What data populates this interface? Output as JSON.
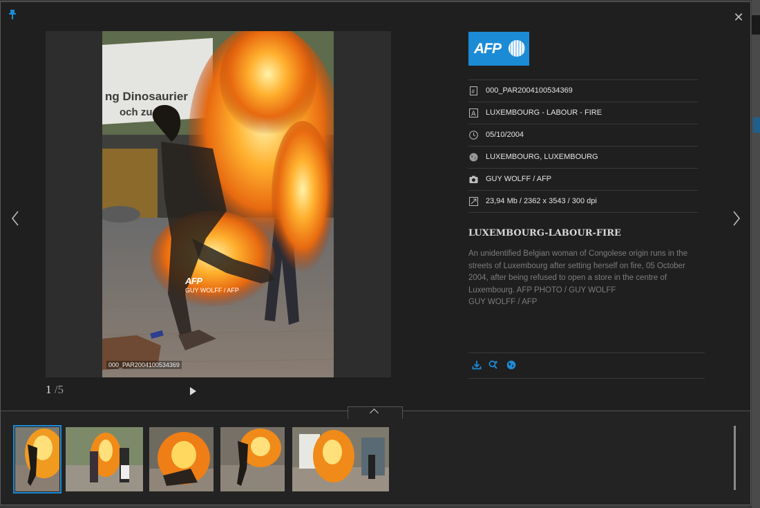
{
  "viewer": {
    "close_glyph": "✕",
    "counter": {
      "current": "1",
      "total": "/5"
    }
  },
  "photo": {
    "watermark_logo": "AFP",
    "watermark_credit": "GUY WOLFF / AFP",
    "id_tag": "000_PAR2004100534369"
  },
  "agency_logo": "AFP",
  "metadata": [
    {
      "icon": "document-id-icon",
      "value": "000_PAR2004100534369"
    },
    {
      "icon": "title-letter-icon",
      "value": "LUXEMBOURG - LABOUR - FIRE"
    },
    {
      "icon": "clock-icon",
      "value": "05/10/2004"
    },
    {
      "icon": "globe-icon",
      "value": "LUXEMBOURG, LUXEMBOURG"
    },
    {
      "icon": "camera-icon",
      "value": "GUY WOLFF / AFP"
    },
    {
      "icon": "resize-icon",
      "value": "23,94 Mb / 2362 x 3543 / 300 dpi"
    }
  ],
  "headline": "LUXEMBOURG-LABOUR-FIRE",
  "caption": {
    "line1": "An unidentified Belgian woman of Congolese origin runs in the streets of Luxembourg after setting herself on fire, 05 October 2004, after being refused to open a store in the centre of Luxembourg. AFP PHOTO / GUY WOLFF",
    "line2": "GUY WOLFF / AFP"
  },
  "actions": [
    "download-icon",
    "search-similar-icon",
    "globe-icon"
  ],
  "colors": {
    "accent": "#1c8bd6",
    "panel": "#1f1f1f",
    "strip": "#232323"
  },
  "thumbnails_count": 5
}
